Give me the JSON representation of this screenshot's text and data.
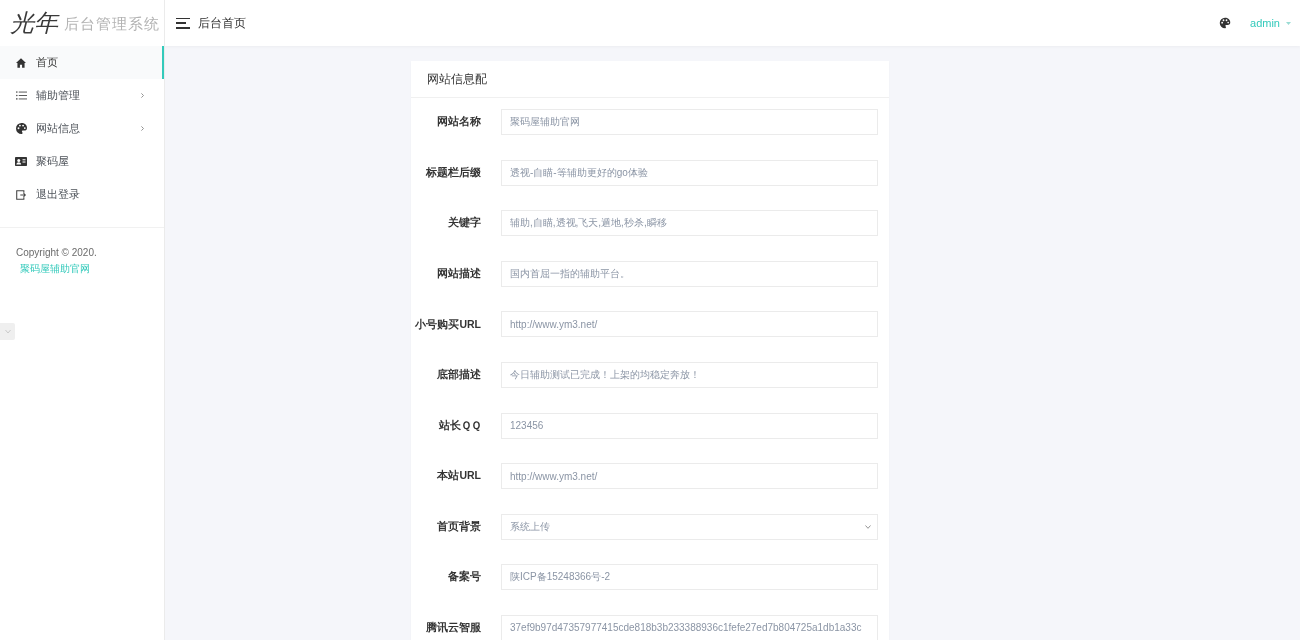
{
  "sidebar": {
    "logo": {
      "mark": "光年",
      "title": "后台管理系统"
    },
    "items": [
      {
        "label": "首页",
        "kind": "link",
        "selected": true
      },
      {
        "label": "辅助管理",
        "kind": "submenu",
        "selected": false
      },
      {
        "label": "网站信息",
        "kind": "submenu",
        "selected": false
      },
      {
        "label": "聚码屋",
        "kind": "link",
        "selected": false
      },
      {
        "label": "退出登录",
        "kind": "link",
        "selected": false
      }
    ],
    "copyright": {
      "text": "Copyright © 2020.",
      "link": "聚码屋辅助官网"
    }
  },
  "topbar": {
    "title": "后台首页",
    "user": "admin"
  },
  "card": {
    "title": "网站信息配",
    "fields": [
      {
        "label": "网站名称",
        "kind": "text",
        "value": "聚码屋辅助官网"
      },
      {
        "label": "标题栏后缀",
        "kind": "text",
        "value": "透视-自瞄-等辅助更好的go体验"
      },
      {
        "label": "关键字",
        "kind": "text",
        "value": "辅助,自瞄,透视,飞天,遁地,秒杀,瞬移"
      },
      {
        "label": "网站描述",
        "kind": "text",
        "value": "国内首屈一指的辅助平台。"
      },
      {
        "label": "小号购买URL",
        "kind": "text",
        "value": "http://www.ym3.net/"
      },
      {
        "label": "底部描述",
        "kind": "text",
        "value": "今日辅助测试已完成！上架的均稳定奔放！"
      },
      {
        "label": "站长ＱＱ",
        "kind": "text",
        "value": "123456"
      },
      {
        "label": "本站URL",
        "kind": "text",
        "value": "http://www.ym3.net/"
      },
      {
        "label": "首页背景",
        "kind": "select",
        "value": "系统上传"
      },
      {
        "label": "备案号",
        "kind": "text",
        "value": "陕ICP备15248366号-2"
      },
      {
        "label": "腾讯云智服",
        "kind": "text",
        "value": "37ef9b97d47357977415cde818b3b233388936c1fefe27ed7b804725a1db1a33c"
      }
    ]
  }
}
